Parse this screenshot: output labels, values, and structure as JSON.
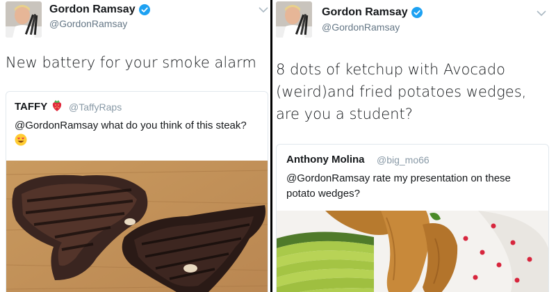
{
  "left": {
    "author": {
      "name": "Gordon Ramsay",
      "handle": "@GordonRamsay"
    },
    "text": "New battery for your smoke alarm",
    "quote": {
      "name": "TAFFY",
      "handle": "@TaffyRaps",
      "text": "@GordonRamsay what do you think of this steak?",
      "name_emoji": "strawberry-icon",
      "text_emoji": "smiling-face-with-heart-eyes-icon"
    }
  },
  "right": {
    "author": {
      "name": "Gordon Ramsay",
      "handle": "@GordonRamsay"
    },
    "text": "8 dots of ketchup with Avocado (weird)and fried potatoes wedges, are you a student?",
    "quote": {
      "name": "Anthony Molina",
      "handle": "@big_mo66",
      "text": "@GordonRamsay rate my presentation on these potato wedges?"
    }
  },
  "colors": {
    "verified": "#1da1f2",
    "secondary_text": "#657786",
    "border": "#e1e8ed",
    "ketchup": "#d7263d"
  }
}
